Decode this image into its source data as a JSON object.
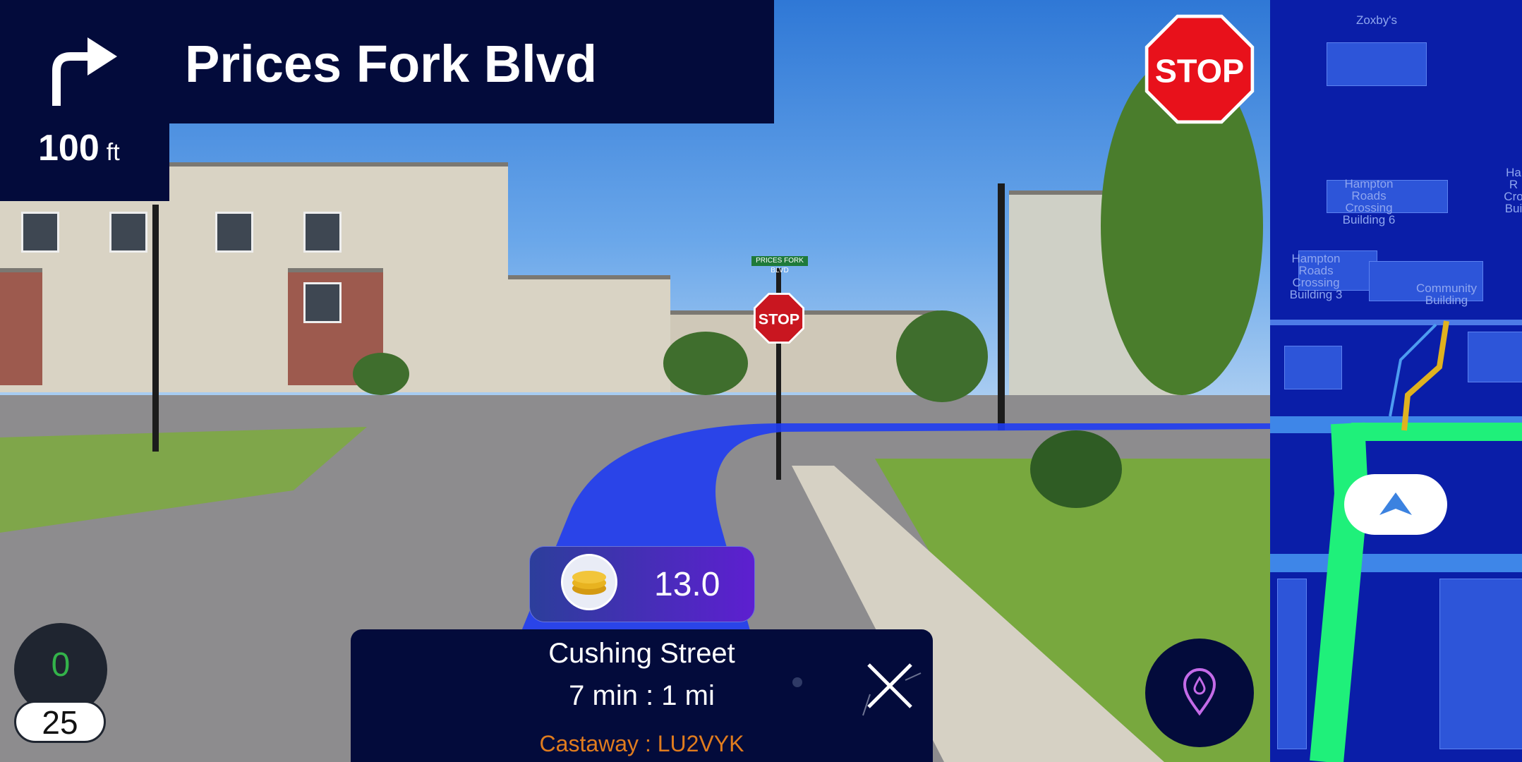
{
  "maneuver": {
    "street": "Prices Fork Blvd",
    "distance_value": "100",
    "distance_unit": "ft"
  },
  "scene_signs": {
    "street_sign": "PRICES FORK BLVD",
    "stop_small": "STOP"
  },
  "hazard_alert": {
    "label": "STOP",
    "color": "#e8111b"
  },
  "speed": {
    "current": "0",
    "limit": "25"
  },
  "reward": {
    "value": "13.0",
    "icon": "coins-icon"
  },
  "trip": {
    "destination": "Cushing Street",
    "eta": "7 min : 1 mi",
    "player": "Castaway : LU2VYK"
  },
  "minimap": {
    "labels": [
      "Zoxby's",
      "Hampton\nRoads\nCrossing\nBuilding 6",
      "Hampton\nRoads\nCrossing\nBuilding 3",
      "Community\nBuilding",
      "Ha\nR\nCro\nBui"
    ]
  },
  "colors": {
    "panel": "#030b3b",
    "route": "#1f3cf2",
    "map_route": "#1ff07a",
    "speed_ok": "#33b34a",
    "player_tag": "#e07c1e"
  }
}
